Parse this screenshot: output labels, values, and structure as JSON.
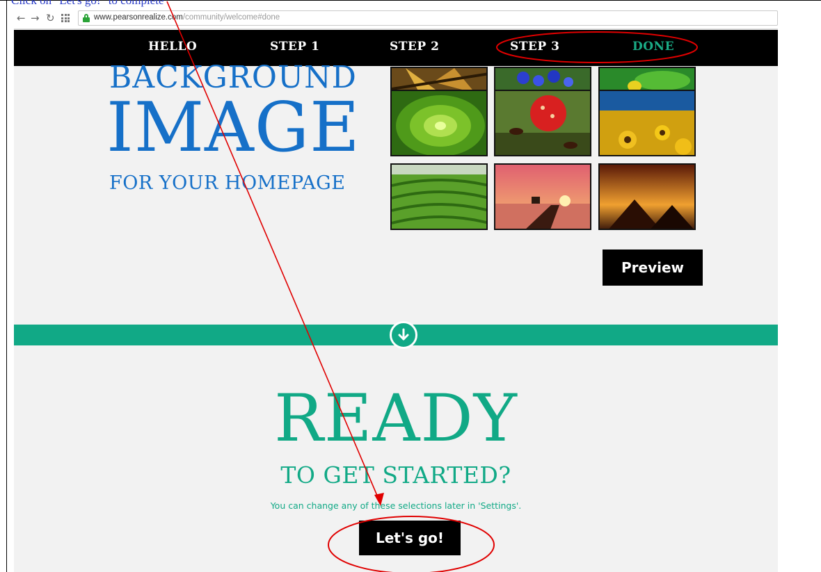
{
  "doc": {
    "caption": "Click on \"Let's go!\" to complete"
  },
  "browser": {
    "url_host": "www.pearsonrealize.com",
    "url_path": "/community/welcome#done"
  },
  "steps": [
    {
      "label": "HELLO"
    },
    {
      "label": "STEP 1"
    },
    {
      "label": "STEP 2"
    },
    {
      "label": "STEP 3"
    },
    {
      "label": "DONE",
      "active": true
    }
  ],
  "hero": {
    "line1": "BACKGROUND",
    "line2": "IMAGE",
    "line3": "FOR YOUR HOMEPAGE"
  },
  "thumbnails": [
    {
      "icon": "star-image-icon"
    },
    {
      "icon": "blue-flowers-image-icon"
    },
    {
      "icon": "green-leaf-image-icon"
    },
    {
      "icon": "succulent-image-icon"
    },
    {
      "icon": "strawberry-ants-image-icon"
    },
    {
      "icon": "sunflower-field-image-icon"
    },
    {
      "icon": "tea-terraces-image-icon"
    },
    {
      "icon": "sunset-pier-image-icon"
    },
    {
      "icon": "pyramids-image-icon"
    }
  ],
  "buttons": {
    "preview": "Preview",
    "lets_go": "Let's go!"
  },
  "ready": {
    "big": "READY",
    "sub": "TO GET STARTED?",
    "note": "You can change any of these selections later in 'Settings'."
  },
  "colors": {
    "accent_teal": "#11a986",
    "hero_blue": "#1670c8",
    "annotation_red": "#e00000"
  }
}
